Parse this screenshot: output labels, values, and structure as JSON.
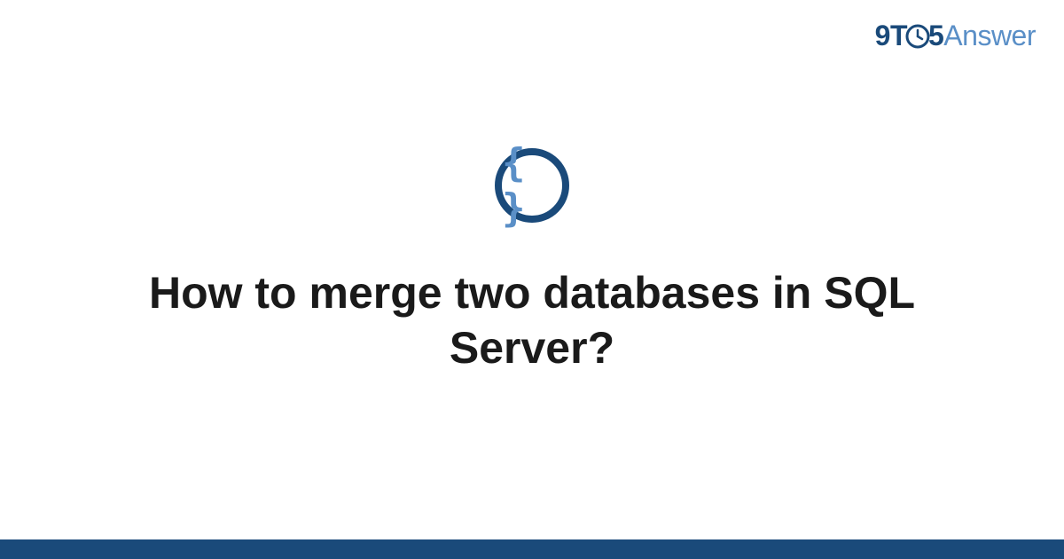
{
  "logo": {
    "part1": "9T",
    "part2": "5",
    "part3": "Answer"
  },
  "category_icon": {
    "name": "code-braces-icon",
    "glyph": "{ }"
  },
  "question": {
    "title": "How to merge two databases in SQL Server?"
  },
  "colors": {
    "primary": "#1a4a7a",
    "accent": "#5a8fc7"
  }
}
